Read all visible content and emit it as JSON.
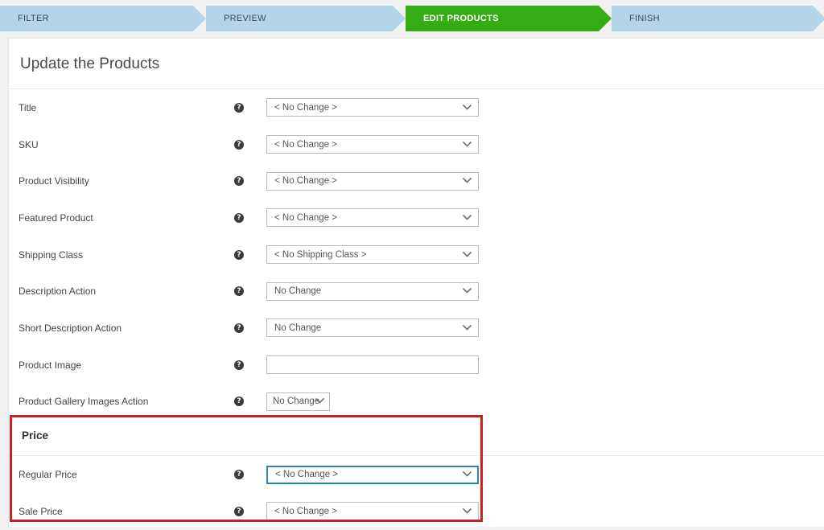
{
  "wizard": {
    "steps": [
      {
        "id": "filter",
        "label": "FILTER",
        "state": "pending"
      },
      {
        "id": "preview",
        "label": "PREVIEW",
        "state": "pending"
      },
      {
        "id": "edit-products",
        "label": "EDIT PRODUCTS",
        "state": "active"
      },
      {
        "id": "finish",
        "label": "FINISH",
        "state": "pending"
      }
    ],
    "colors": {
      "pending_bg": "#b4d5e8",
      "pending_text": "#3b4a55",
      "active_bg": "#35ac12",
      "active_text": "#ffffff"
    }
  },
  "page": {
    "title": "Update the Products"
  },
  "help_icon_glyph": "?",
  "chevron_icon": "chevron-down-icon",
  "fields": [
    {
      "label": "Title",
      "control": "select",
      "value": "< No Change >"
    },
    {
      "label": "SKU",
      "control": "select",
      "value": "< No Change >"
    },
    {
      "label": "Product Visibility",
      "control": "select",
      "value": "< No Change >"
    },
    {
      "label": "Featured Product",
      "control": "select",
      "value": "< No Change >"
    },
    {
      "label": "Shipping Class",
      "control": "select",
      "value": "< No Shipping Class >"
    },
    {
      "label": "Description Action",
      "control": "select",
      "value": "No Change"
    },
    {
      "label": "Short Description Action",
      "control": "select",
      "value": "No Change"
    },
    {
      "label": "Product Image",
      "control": "text",
      "value": "",
      "placeholder": ""
    },
    {
      "label": "Product Gallery Images Action",
      "control": "select-narrow",
      "value": "No Change"
    }
  ],
  "price_section": {
    "heading": "Price",
    "fields": [
      {
        "label": "Regular Price",
        "control": "select",
        "value": "< No Change >",
        "focused": true
      },
      {
        "label": "Sale Price",
        "control": "select",
        "value": "< No Change >",
        "focused": false
      }
    ]
  },
  "annotation": {
    "name": "price-section-highlight",
    "color": "#cc1f1f"
  }
}
